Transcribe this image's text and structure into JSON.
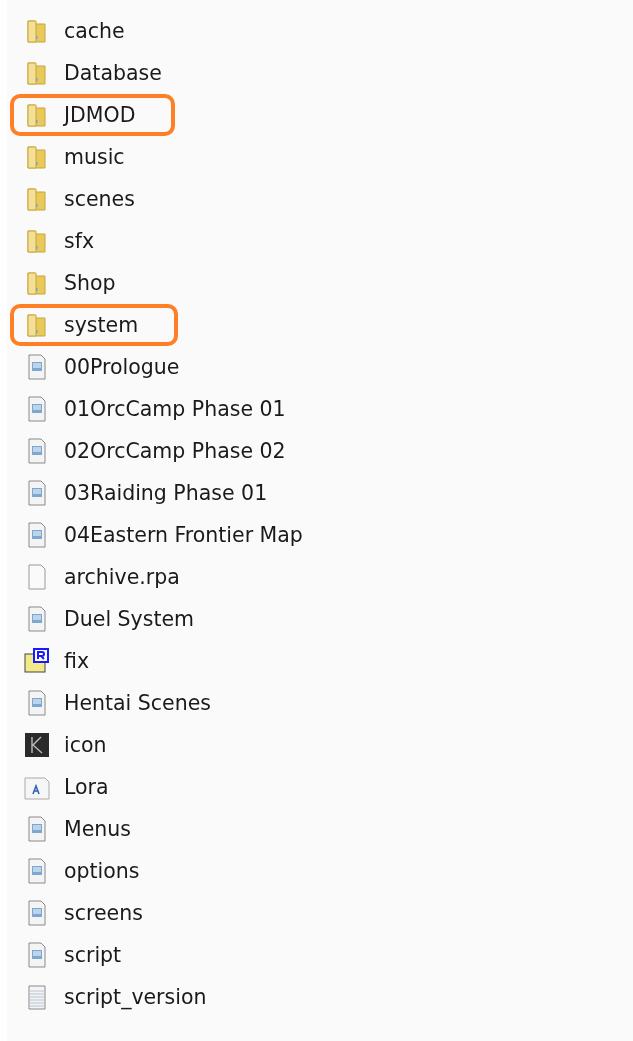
{
  "files": [
    {
      "name": "cache",
      "kind": "folder",
      "highlighted": false
    },
    {
      "name": "Database",
      "kind": "folder",
      "highlighted": false
    },
    {
      "name": "JDMOD",
      "kind": "folder",
      "highlighted": true
    },
    {
      "name": "music",
      "kind": "folder",
      "highlighted": false
    },
    {
      "name": "scenes",
      "kind": "folder",
      "highlighted": false
    },
    {
      "name": "sfx",
      "kind": "folder",
      "highlighted": false
    },
    {
      "name": "Shop",
      "kind": "folder",
      "highlighted": false
    },
    {
      "name": "system",
      "kind": "folder",
      "highlighted": true
    },
    {
      "name": "00Prologue",
      "kind": "script",
      "highlighted": false
    },
    {
      "name": "01OrcCamp Phase 01",
      "kind": "script",
      "highlighted": false
    },
    {
      "name": "02OrcCamp Phase 02",
      "kind": "script",
      "highlighted": false
    },
    {
      "name": "03Raiding Phase 01",
      "kind": "script",
      "highlighted": false
    },
    {
      "name": "04Eastern Frontier Map",
      "kind": "script",
      "highlighted": false
    },
    {
      "name": "archive.rpa",
      "kind": "blank",
      "highlighted": false
    },
    {
      "name": "Duel System",
      "kind": "script",
      "highlighted": false
    },
    {
      "name": "fix",
      "kind": "renpy",
      "highlighted": false
    },
    {
      "name": "Hentai Scenes",
      "kind": "script",
      "highlighted": false
    },
    {
      "name": "icon",
      "kind": "image",
      "highlighted": false
    },
    {
      "name": "Lora",
      "kind": "font",
      "highlighted": false
    },
    {
      "name": "Menus",
      "kind": "script",
      "highlighted": false
    },
    {
      "name": "options",
      "kind": "script",
      "highlighted": false
    },
    {
      "name": "screens",
      "kind": "script",
      "highlighted": false
    },
    {
      "name": "script",
      "kind": "script",
      "highlighted": false
    },
    {
      "name": "script_version",
      "kind": "text",
      "highlighted": false
    }
  ]
}
